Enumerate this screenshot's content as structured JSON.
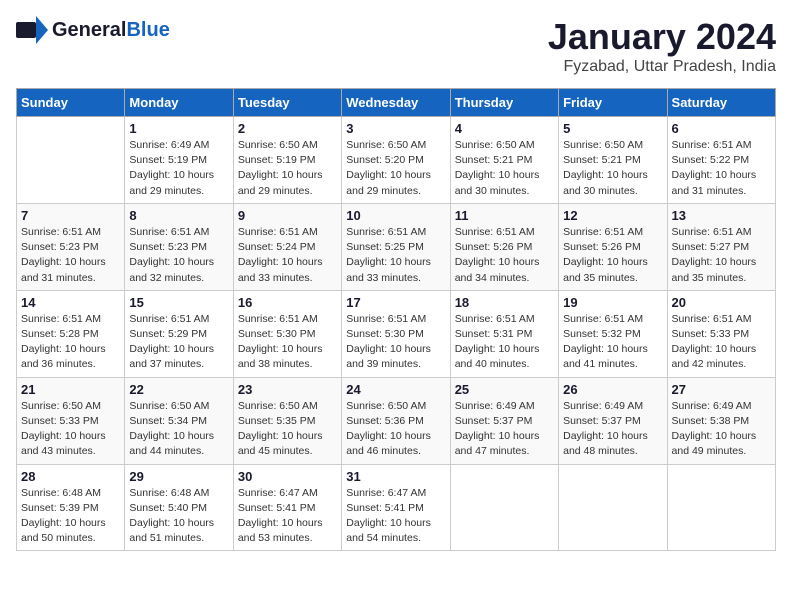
{
  "header": {
    "logo_general": "General",
    "logo_blue": "Blue",
    "title": "January 2024",
    "location": "Fyzabad, Uttar Pradesh, India"
  },
  "calendar": {
    "days_of_week": [
      "Sunday",
      "Monday",
      "Tuesday",
      "Wednesday",
      "Thursday",
      "Friday",
      "Saturday"
    ],
    "weeks": [
      [
        {
          "day": "",
          "info": ""
        },
        {
          "day": "1",
          "info": "Sunrise: 6:49 AM\nSunset: 5:19 PM\nDaylight: 10 hours\nand 29 minutes."
        },
        {
          "day": "2",
          "info": "Sunrise: 6:50 AM\nSunset: 5:19 PM\nDaylight: 10 hours\nand 29 minutes."
        },
        {
          "day": "3",
          "info": "Sunrise: 6:50 AM\nSunset: 5:20 PM\nDaylight: 10 hours\nand 29 minutes."
        },
        {
          "day": "4",
          "info": "Sunrise: 6:50 AM\nSunset: 5:21 PM\nDaylight: 10 hours\nand 30 minutes."
        },
        {
          "day": "5",
          "info": "Sunrise: 6:50 AM\nSunset: 5:21 PM\nDaylight: 10 hours\nand 30 minutes."
        },
        {
          "day": "6",
          "info": "Sunrise: 6:51 AM\nSunset: 5:22 PM\nDaylight: 10 hours\nand 31 minutes."
        }
      ],
      [
        {
          "day": "7",
          "info": "Sunrise: 6:51 AM\nSunset: 5:23 PM\nDaylight: 10 hours\nand 31 minutes."
        },
        {
          "day": "8",
          "info": "Sunrise: 6:51 AM\nSunset: 5:23 PM\nDaylight: 10 hours\nand 32 minutes."
        },
        {
          "day": "9",
          "info": "Sunrise: 6:51 AM\nSunset: 5:24 PM\nDaylight: 10 hours\nand 33 minutes."
        },
        {
          "day": "10",
          "info": "Sunrise: 6:51 AM\nSunset: 5:25 PM\nDaylight: 10 hours\nand 33 minutes."
        },
        {
          "day": "11",
          "info": "Sunrise: 6:51 AM\nSunset: 5:26 PM\nDaylight: 10 hours\nand 34 minutes."
        },
        {
          "day": "12",
          "info": "Sunrise: 6:51 AM\nSunset: 5:26 PM\nDaylight: 10 hours\nand 35 minutes."
        },
        {
          "day": "13",
          "info": "Sunrise: 6:51 AM\nSunset: 5:27 PM\nDaylight: 10 hours\nand 35 minutes."
        }
      ],
      [
        {
          "day": "14",
          "info": "Sunrise: 6:51 AM\nSunset: 5:28 PM\nDaylight: 10 hours\nand 36 minutes."
        },
        {
          "day": "15",
          "info": "Sunrise: 6:51 AM\nSunset: 5:29 PM\nDaylight: 10 hours\nand 37 minutes."
        },
        {
          "day": "16",
          "info": "Sunrise: 6:51 AM\nSunset: 5:30 PM\nDaylight: 10 hours\nand 38 minutes."
        },
        {
          "day": "17",
          "info": "Sunrise: 6:51 AM\nSunset: 5:30 PM\nDaylight: 10 hours\nand 39 minutes."
        },
        {
          "day": "18",
          "info": "Sunrise: 6:51 AM\nSunset: 5:31 PM\nDaylight: 10 hours\nand 40 minutes."
        },
        {
          "day": "19",
          "info": "Sunrise: 6:51 AM\nSunset: 5:32 PM\nDaylight: 10 hours\nand 41 minutes."
        },
        {
          "day": "20",
          "info": "Sunrise: 6:51 AM\nSunset: 5:33 PM\nDaylight: 10 hours\nand 42 minutes."
        }
      ],
      [
        {
          "day": "21",
          "info": "Sunrise: 6:50 AM\nSunset: 5:33 PM\nDaylight: 10 hours\nand 43 minutes."
        },
        {
          "day": "22",
          "info": "Sunrise: 6:50 AM\nSunset: 5:34 PM\nDaylight: 10 hours\nand 44 minutes."
        },
        {
          "day": "23",
          "info": "Sunrise: 6:50 AM\nSunset: 5:35 PM\nDaylight: 10 hours\nand 45 minutes."
        },
        {
          "day": "24",
          "info": "Sunrise: 6:50 AM\nSunset: 5:36 PM\nDaylight: 10 hours\nand 46 minutes."
        },
        {
          "day": "25",
          "info": "Sunrise: 6:49 AM\nSunset: 5:37 PM\nDaylight: 10 hours\nand 47 minutes."
        },
        {
          "day": "26",
          "info": "Sunrise: 6:49 AM\nSunset: 5:37 PM\nDaylight: 10 hours\nand 48 minutes."
        },
        {
          "day": "27",
          "info": "Sunrise: 6:49 AM\nSunset: 5:38 PM\nDaylight: 10 hours\nand 49 minutes."
        }
      ],
      [
        {
          "day": "28",
          "info": "Sunrise: 6:48 AM\nSunset: 5:39 PM\nDaylight: 10 hours\nand 50 minutes."
        },
        {
          "day": "29",
          "info": "Sunrise: 6:48 AM\nSunset: 5:40 PM\nDaylight: 10 hours\nand 51 minutes."
        },
        {
          "day": "30",
          "info": "Sunrise: 6:47 AM\nSunset: 5:41 PM\nDaylight: 10 hours\nand 53 minutes."
        },
        {
          "day": "31",
          "info": "Sunrise: 6:47 AM\nSunset: 5:41 PM\nDaylight: 10 hours\nand 54 minutes."
        },
        {
          "day": "",
          "info": ""
        },
        {
          "day": "",
          "info": ""
        },
        {
          "day": "",
          "info": ""
        }
      ]
    ]
  }
}
